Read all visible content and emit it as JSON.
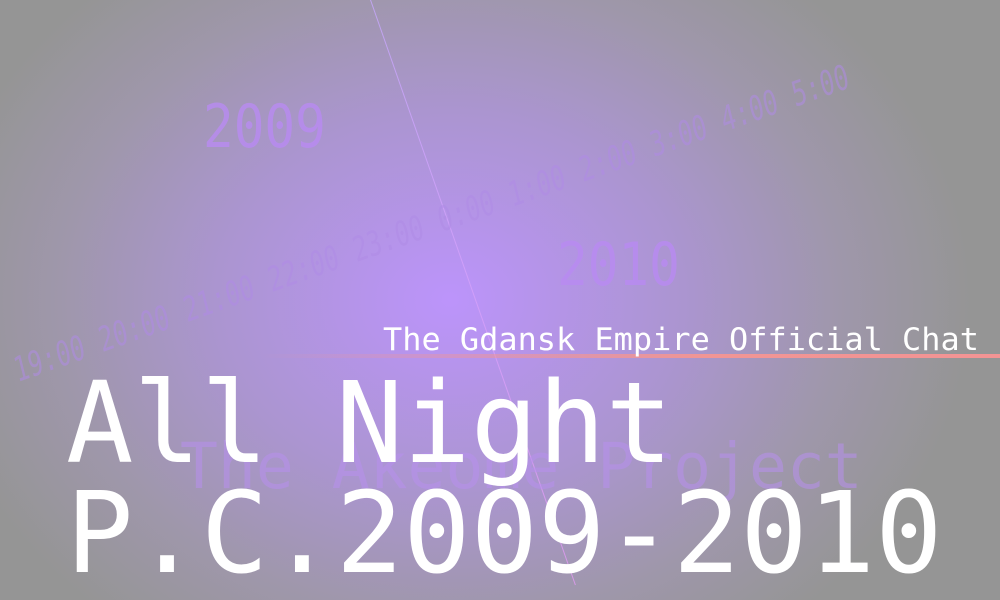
{
  "years": {
    "start": "2009",
    "end": "2010"
  },
  "timeline": [
    "19:00",
    "20:00",
    "21:00",
    "22:00",
    "23:00",
    "0:00",
    "1:00",
    "2:00",
    "3:00",
    "4:00",
    "5:00"
  ],
  "subtitle": "The Gdansk Empire Official Chat",
  "project": "The Akeome Project",
  "title": "All Night",
  "period": "P.C.2009-2010",
  "colors": {
    "center": "#bc94fb",
    "edge": "#959595",
    "accent_line": "#f39494"
  }
}
